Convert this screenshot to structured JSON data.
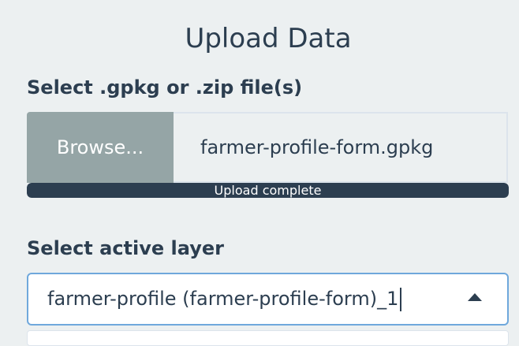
{
  "upload": {
    "title": "Upload Data",
    "file_label": "Select .gpkg or .zip file(s)",
    "browse_label": "Browse...",
    "file_name": "farmer-profile-form.gpkg",
    "progress_text": "Upload complete",
    "progress_fraction": 1.0
  },
  "layer": {
    "label": "Select active layer",
    "selected_value": "farmer-profile (farmer-profile-form)_1"
  },
  "icons": {
    "select_arrow": "triangle-up-icon"
  }
}
